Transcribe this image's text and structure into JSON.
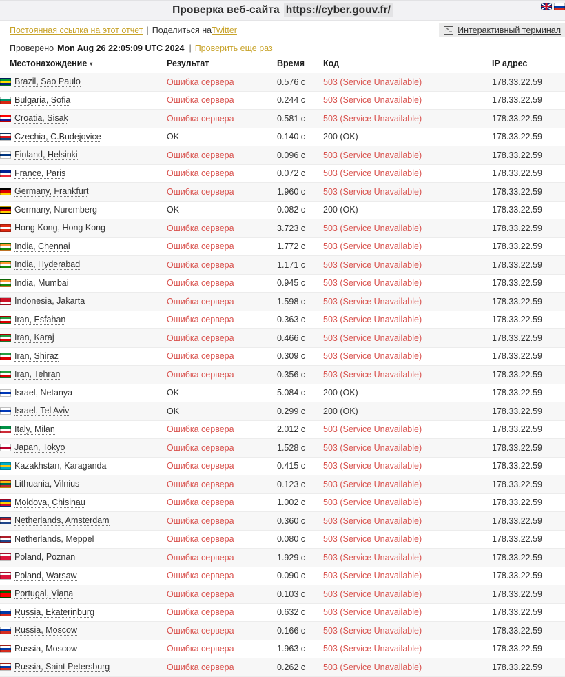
{
  "titlebar": {
    "title": "Проверка веб-сайта",
    "url": "https://cyber.gouv.fr/",
    "flags": [
      "uk-flag-icon",
      "russia-flag-icon"
    ]
  },
  "links": {
    "permalink": "Постоянная ссылка на этот отчет",
    "separator": "|",
    "share_prefix": "Поделиться на ",
    "share_target": "Twitter",
    "terminal_button": "Интерактивный терминал",
    "terminal_icon": ">_"
  },
  "checked": {
    "label": "Проверено",
    "timestamp": "Mon Aug 26 22:05:09 UTC 2024",
    "separator": "|",
    "recheck": "Проверить еще раз"
  },
  "table": {
    "columns": {
      "location": "Местонахождение",
      "result": "Результат",
      "time": "Время",
      "code": "Код",
      "ip": "IP адрес"
    },
    "sort_indicator": "▾",
    "rows": [
      {
        "flag": "brazil-flag-icon",
        "colors": [
          "#009b3a",
          "#fedf00",
          "#002776"
        ],
        "location": "Brazil, Sao Paulo",
        "result": "Ошибка сервера",
        "ok": false,
        "time": "0.576 с",
        "code": "503 (Service Unavailable)",
        "ip": "178.33.22.59"
      },
      {
        "flag": "bulgaria-flag-icon",
        "colors": [
          "#ffffff",
          "#00966e",
          "#d62612"
        ],
        "location": "Bulgaria, Sofia",
        "result": "Ошибка сервера",
        "ok": false,
        "time": "0.244 с",
        "code": "503 (Service Unavailable)",
        "ip": "178.33.22.59"
      },
      {
        "flag": "croatia-flag-icon",
        "colors": [
          "#ff0000",
          "#ffffff",
          "#171796"
        ],
        "location": "Croatia, Sisak",
        "result": "Ошибка сервера",
        "ok": false,
        "time": "0.581 с",
        "code": "503 (Service Unavailable)",
        "ip": "178.33.22.59"
      },
      {
        "flag": "czechia-flag-icon",
        "colors": [
          "#ffffff",
          "#d7141a",
          "#11457e"
        ],
        "location": "Czechia, C.Budejovice",
        "result": "OK",
        "ok": true,
        "time": "0.140 с",
        "code": "200 (OK)",
        "ip": "178.33.22.59"
      },
      {
        "flag": "finland-flag-icon",
        "colors": [
          "#ffffff",
          "#003580",
          "#ffffff"
        ],
        "location": "Finland, Helsinki",
        "result": "Ошибка сервера",
        "ok": false,
        "time": "0.096 с",
        "code": "503 (Service Unavailable)",
        "ip": "178.33.22.59"
      },
      {
        "flag": "france-flag-icon",
        "colors": [
          "#002395",
          "#ffffff",
          "#ed2939"
        ],
        "location": "France, Paris",
        "result": "Ошибка сервера",
        "ok": false,
        "time": "0.072 с",
        "code": "503 (Service Unavailable)",
        "ip": "178.33.22.59"
      },
      {
        "flag": "germany-flag-icon",
        "colors": [
          "#000000",
          "#dd0000",
          "#ffce00"
        ],
        "location": "Germany, Frankfurt",
        "result": "Ошибка сервера",
        "ok": false,
        "time": "1.960 с",
        "code": "503 (Service Unavailable)",
        "ip": "178.33.22.59"
      },
      {
        "flag": "germany-flag-icon",
        "colors": [
          "#000000",
          "#dd0000",
          "#ffce00"
        ],
        "location": "Germany, Nuremberg",
        "result": "OK",
        "ok": true,
        "time": "0.082 с",
        "code": "200 (OK)",
        "ip": "178.33.22.59"
      },
      {
        "flag": "hongkong-flag-icon",
        "colors": [
          "#de2910",
          "#ffffff",
          "#de2910"
        ],
        "location": "Hong Kong, Hong Kong",
        "result": "Ошибка сервера",
        "ok": false,
        "time": "3.723 с",
        "code": "503 (Service Unavailable)",
        "ip": "178.33.22.59"
      },
      {
        "flag": "india-flag-icon",
        "colors": [
          "#ff9933",
          "#ffffff",
          "#138808"
        ],
        "location": "India, Chennai",
        "result": "Ошибка сервера",
        "ok": false,
        "time": "1.772 с",
        "code": "503 (Service Unavailable)",
        "ip": "178.33.22.59"
      },
      {
        "flag": "india-flag-icon",
        "colors": [
          "#ff9933",
          "#ffffff",
          "#138808"
        ],
        "location": "India, Hyderabad",
        "result": "Ошибка сервера",
        "ok": false,
        "time": "1.171 с",
        "code": "503 (Service Unavailable)",
        "ip": "178.33.22.59"
      },
      {
        "flag": "india-flag-icon",
        "colors": [
          "#ff9933",
          "#ffffff",
          "#138808"
        ],
        "location": "India, Mumbai",
        "result": "Ошибка сервера",
        "ok": false,
        "time": "0.945 с",
        "code": "503 (Service Unavailable)",
        "ip": "178.33.22.59"
      },
      {
        "flag": "indonesia-flag-icon",
        "colors": [
          "#ce1126",
          "#ce1126",
          "#ffffff"
        ],
        "location": "Indonesia, Jakarta",
        "result": "Ошибка сервера",
        "ok": false,
        "time": "1.598 с",
        "code": "503 (Service Unavailable)",
        "ip": "178.33.22.59"
      },
      {
        "flag": "iran-flag-icon",
        "colors": [
          "#239f40",
          "#ffffff",
          "#da0000"
        ],
        "location": "Iran, Esfahan",
        "result": "Ошибка сервера",
        "ok": false,
        "time": "0.363 с",
        "code": "503 (Service Unavailable)",
        "ip": "178.33.22.59"
      },
      {
        "flag": "iran-flag-icon",
        "colors": [
          "#239f40",
          "#ffffff",
          "#da0000"
        ],
        "location": "Iran, Karaj",
        "result": "Ошибка сервера",
        "ok": false,
        "time": "0.466 с",
        "code": "503 (Service Unavailable)",
        "ip": "178.33.22.59"
      },
      {
        "flag": "iran-flag-icon",
        "colors": [
          "#239f40",
          "#ffffff",
          "#da0000"
        ],
        "location": "Iran, Shiraz",
        "result": "Ошибка сервера",
        "ok": false,
        "time": "0.309 с",
        "code": "503 (Service Unavailable)",
        "ip": "178.33.22.59"
      },
      {
        "flag": "iran-flag-icon",
        "colors": [
          "#239f40",
          "#ffffff",
          "#da0000"
        ],
        "location": "Iran, Tehran",
        "result": "Ошибка сервера",
        "ok": false,
        "time": "0.356 с",
        "code": "503 (Service Unavailable)",
        "ip": "178.33.22.59"
      },
      {
        "flag": "israel-flag-icon",
        "colors": [
          "#ffffff",
          "#0038b8",
          "#ffffff"
        ],
        "location": "Israel, Netanya",
        "result": "OK",
        "ok": true,
        "time": "5.084 с",
        "code": "200 (OK)",
        "ip": "178.33.22.59"
      },
      {
        "flag": "israel-flag-icon",
        "colors": [
          "#ffffff",
          "#0038b8",
          "#ffffff"
        ],
        "location": "Israel, Tel Aviv",
        "result": "OK",
        "ok": true,
        "time": "0.299 с",
        "code": "200 (OK)",
        "ip": "178.33.22.59"
      },
      {
        "flag": "italy-flag-icon",
        "colors": [
          "#009246",
          "#ffffff",
          "#ce2b37"
        ],
        "location": "Italy, Milan",
        "result": "Ошибка сервера",
        "ok": false,
        "time": "2.012 с",
        "code": "503 (Service Unavailable)",
        "ip": "178.33.22.59"
      },
      {
        "flag": "japan-flag-icon",
        "colors": [
          "#ffffff",
          "#bc002d",
          "#ffffff"
        ],
        "location": "Japan, Tokyo",
        "result": "Ошибка сервера",
        "ok": false,
        "time": "1.528 с",
        "code": "503 (Service Unavailable)",
        "ip": "178.33.22.59"
      },
      {
        "flag": "kazakhstan-flag-icon",
        "colors": [
          "#00afca",
          "#fec50c",
          "#00afca"
        ],
        "location": "Kazakhstan, Karaganda",
        "result": "Ошибка сервера",
        "ok": false,
        "time": "0.415 с",
        "code": "503 (Service Unavailable)",
        "ip": "178.33.22.59"
      },
      {
        "flag": "lithuania-flag-icon",
        "colors": [
          "#fdb913",
          "#006a44",
          "#c1272d"
        ],
        "location": "Lithuania, Vilnius",
        "result": "Ошибка сервера",
        "ok": false,
        "time": "0.123 с",
        "code": "503 (Service Unavailable)",
        "ip": "178.33.22.59"
      },
      {
        "flag": "moldova-flag-icon",
        "colors": [
          "#0046ae",
          "#ffd200",
          "#cc092f"
        ],
        "location": "Moldova, Chisinau",
        "result": "Ошибка сервера",
        "ok": false,
        "time": "1.002 с",
        "code": "503 (Service Unavailable)",
        "ip": "178.33.22.59"
      },
      {
        "flag": "netherlands-flag-icon",
        "colors": [
          "#ae1c28",
          "#ffffff",
          "#21468b"
        ],
        "location": "Netherlands, Amsterdam",
        "result": "Ошибка сервера",
        "ok": false,
        "time": "0.360 с",
        "code": "503 (Service Unavailable)",
        "ip": "178.33.22.59"
      },
      {
        "flag": "netherlands-flag-icon",
        "colors": [
          "#ae1c28",
          "#ffffff",
          "#21468b"
        ],
        "location": "Netherlands, Meppel",
        "result": "Ошибка сервера",
        "ok": false,
        "time": "0.080 с",
        "code": "503 (Service Unavailable)",
        "ip": "178.33.22.59"
      },
      {
        "flag": "poland-flag-icon",
        "colors": [
          "#ffffff",
          "#dc143c",
          "#dc143c"
        ],
        "location": "Poland, Poznan",
        "result": "Ошибка сервера",
        "ok": false,
        "time": "1.929 с",
        "code": "503 (Service Unavailable)",
        "ip": "178.33.22.59"
      },
      {
        "flag": "poland-flag-icon",
        "colors": [
          "#ffffff",
          "#dc143c",
          "#dc143c"
        ],
        "location": "Poland, Warsaw",
        "result": "Ошибка сервера",
        "ok": false,
        "time": "0.090 с",
        "code": "503 (Service Unavailable)",
        "ip": "178.33.22.59"
      },
      {
        "flag": "portugal-flag-icon",
        "colors": [
          "#006600",
          "#ff0000",
          "#ff0000"
        ],
        "location": "Portugal, Viana",
        "result": "Ошибка сервера",
        "ok": false,
        "time": "0.103 с",
        "code": "503 (Service Unavailable)",
        "ip": "178.33.22.59"
      },
      {
        "flag": "russia-flag-icon",
        "colors": [
          "#ffffff",
          "#0039a6",
          "#d52b1e"
        ],
        "location": "Russia, Ekaterinburg",
        "result": "Ошибка сервера",
        "ok": false,
        "time": "0.632 с",
        "code": "503 (Service Unavailable)",
        "ip": "178.33.22.59"
      },
      {
        "flag": "russia-flag-icon",
        "colors": [
          "#ffffff",
          "#0039a6",
          "#d52b1e"
        ],
        "location": "Russia, Moscow",
        "result": "Ошибка сервера",
        "ok": false,
        "time": "0.166 с",
        "code": "503 (Service Unavailable)",
        "ip": "178.33.22.59"
      },
      {
        "flag": "russia-flag-icon",
        "colors": [
          "#ffffff",
          "#0039a6",
          "#d52b1e"
        ],
        "location": "Russia, Moscow",
        "result": "Ошибка сервера",
        "ok": false,
        "time": "1.963 с",
        "code": "503 (Service Unavailable)",
        "ip": "178.33.22.59"
      },
      {
        "flag": "russia-flag-icon",
        "colors": [
          "#ffffff",
          "#0039a6",
          "#d52b1e"
        ],
        "location": "Russia, Saint Petersburg",
        "result": "Ошибка сервера",
        "ok": false,
        "time": "0.262 с",
        "code": "503 (Service Unavailable)",
        "ip": "178.33.22.59"
      }
    ]
  },
  "colors": {
    "error": "#d9534f",
    "link": "#c8a32a",
    "row_alt": "#f7f7f7",
    "titlebar_bg": "#f2f2f4"
  }
}
